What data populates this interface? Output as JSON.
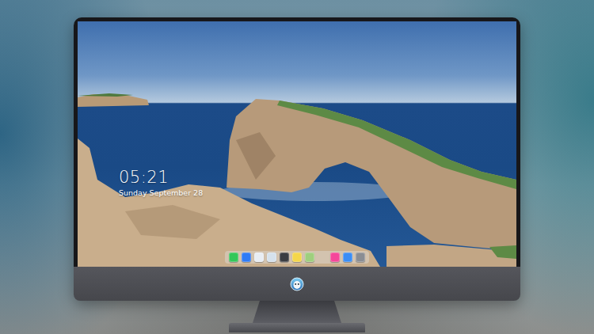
{
  "desktop": {
    "clock": "05:21",
    "date": "Sunday September 28"
  },
  "dock": {
    "items": [
      {
        "kind": "app",
        "color": "#34c759"
      },
      {
        "kind": "app",
        "color": "#2f7bf6"
      },
      {
        "kind": "app",
        "color": "#e8edf3"
      },
      {
        "kind": "app",
        "color": "#d5e1ec"
      },
      {
        "kind": "app",
        "color": "#3b3d42"
      },
      {
        "kind": "app",
        "color": "#f5d64a"
      },
      {
        "kind": "app",
        "color": "#9fcf7e"
      },
      {
        "kind": "separator"
      },
      {
        "kind": "app",
        "color": "#f5479a"
      },
      {
        "kind": "app",
        "color": "#3a8df5"
      },
      {
        "kind": "app",
        "color": "#8a8d93"
      }
    ]
  }
}
